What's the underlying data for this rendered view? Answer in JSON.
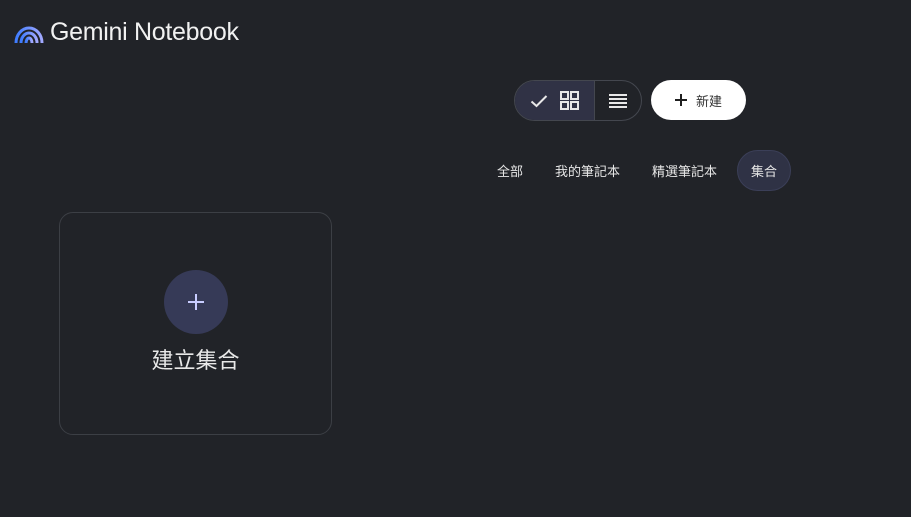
{
  "app": {
    "title": "Gemini Notebook",
    "logo_icon": "gemini-arc-logo-icon"
  },
  "toolbar": {
    "view_toggle": {
      "selected": "grid",
      "check_icon": "check-icon",
      "grid_icon": "grid-view-icon",
      "list_icon": "list-view-icon"
    },
    "new_button": {
      "icon": "plus-icon",
      "label": "新建"
    }
  },
  "tabs": [
    {
      "label": "全部",
      "active": false
    },
    {
      "label": "我的筆記本",
      "active": false
    },
    {
      "label": "精選筆記本",
      "active": false
    },
    {
      "label": "集合",
      "active": true
    }
  ],
  "create_card": {
    "icon": "plus-icon",
    "label": "建立集合"
  },
  "colors": {
    "background": "#212328",
    "accent_purple": "#363a57",
    "plus_accent": "#c8ccff",
    "logo_gradient": [
      "#4f8cff",
      "#9aa7ff"
    ]
  }
}
